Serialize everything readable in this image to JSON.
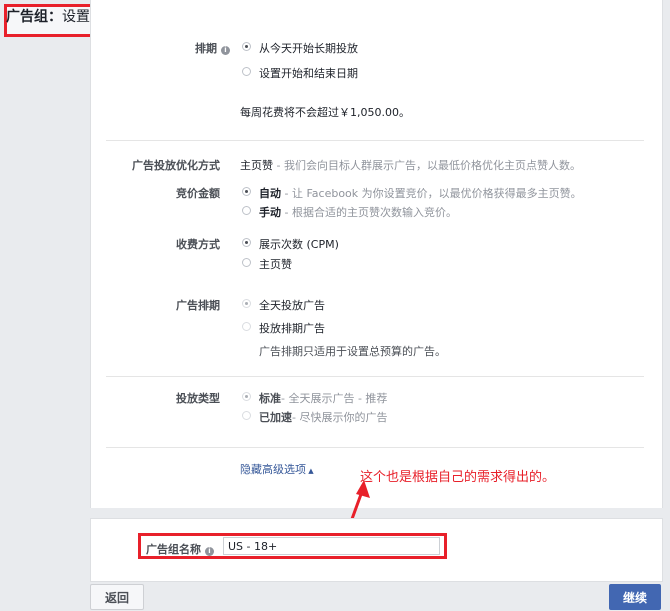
{
  "header": {
    "title_bold": "广告组：",
    "title_rest": "设置受众、预算和排期"
  },
  "schedule": {
    "label": "排期",
    "options": [
      {
        "text": "从今天开始长期投放",
        "checked": true
      },
      {
        "text": "设置开始和结束日期",
        "checked": false
      }
    ],
    "weekly_note": "每周花费将不会超过￥1,050.00。"
  },
  "optimization": {
    "label": "广告投放优化方式",
    "value_bold": "主页赞",
    "value_desc": " - 我们会向目标人群展示广告，以最低价格优化主页点赞人数。"
  },
  "bid": {
    "label": "竞价金额",
    "options": [
      {
        "bold": "自动",
        "desc": " - 让 Facebook 为你设置竞价，以最优价格获得最多主页赞。",
        "checked": true
      },
      {
        "bold": "手动",
        "desc": " - 根据合适的主页赞次数输入竞价。",
        "checked": false
      }
    ]
  },
  "charge": {
    "label": "收费方式",
    "options": [
      {
        "text": "展示次数 (CPM)",
        "checked": true
      },
      {
        "text": "主页赞",
        "checked": false
      }
    ]
  },
  "ad_schedule": {
    "label": "广告排期",
    "options": [
      {
        "text": "全天投放广告",
        "checked": true
      },
      {
        "text": "投放排期广告",
        "checked": false
      }
    ],
    "note": "广告排期只适用于设置总预算的广告。"
  },
  "delivery": {
    "label": "投放类型",
    "options": [
      {
        "bold": "标准",
        "desc": "- 全天展示广告 - 推荐",
        "checked": true
      },
      {
        "bold": "已加速",
        "desc": "- 尽快展示你的广告",
        "checked": false
      }
    ]
  },
  "advanced_link": "隐藏高级选项",
  "annotation": "这个也是根据自己的需求得出的。",
  "adset_name": {
    "label": "广告组名称",
    "value": "US - 18+"
  },
  "buttons": {
    "back": "返回",
    "continue": "继续"
  },
  "colors": {
    "annotation_red": "#e8202a",
    "link_blue": "#365899",
    "primary_button": "#4267b2"
  }
}
